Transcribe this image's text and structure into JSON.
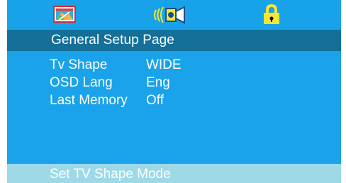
{
  "header": {
    "tabs": [
      {
        "icon": "general-setup-icon",
        "selected": true
      },
      {
        "icon": "audio-speaker-icon",
        "selected": false
      },
      {
        "icon": "lock-icon",
        "selected": false
      }
    ]
  },
  "page": {
    "title": "General Setup Page"
  },
  "settings": [
    {
      "label": "Tv Shape",
      "value": "WIDE"
    },
    {
      "label": "OSD Lang",
      "value": "Eng"
    },
    {
      "label": "Last Memory",
      "value": "Off"
    }
  ],
  "status": {
    "text": "Set TV Shape Mode"
  },
  "colors": {
    "background": "#1aa3ea",
    "title_bar": "#147099",
    "status_bar": "#9ed9e8",
    "text": "#ffffff",
    "lock_icon": "#f4e632"
  }
}
